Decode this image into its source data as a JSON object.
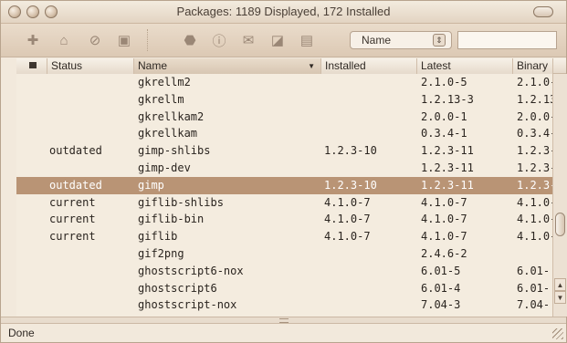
{
  "window": {
    "title": "Packages: 1189 Displayed, 172 Installed"
  },
  "toolbar": {
    "sort_select_value": "Name",
    "search_value": "",
    "buttons": [
      {
        "name": "install-icon",
        "glyph": "✚"
      },
      {
        "name": "install-binary-icon",
        "glyph": "⌂"
      },
      {
        "name": "remove-icon",
        "glyph": "⊘"
      },
      {
        "name": "package-icon",
        "glyph": "▣"
      },
      {
        "name": "stop-icon",
        "glyph": "⬣"
      },
      {
        "name": "info-icon",
        "glyph": "ⓘ"
      },
      {
        "name": "feedback-icon",
        "glyph": "✉"
      },
      {
        "name": "terminal-icon",
        "glyph": "◪"
      },
      {
        "name": "preferences-icon",
        "glyph": "▤"
      }
    ]
  },
  "table": {
    "columns": {
      "status": "Status",
      "name": "Name",
      "installed": "Installed",
      "latest": "Latest",
      "binary": "Binary"
    },
    "rows": [
      {
        "status": "",
        "name": "gkrellm2",
        "installed": "",
        "latest": "2.1.0-5",
        "binary": "2.1.0-"
      },
      {
        "status": "",
        "name": "gkrellm",
        "installed": "",
        "latest": "1.2.13-3",
        "binary": "1.2.13"
      },
      {
        "status": "",
        "name": "gkrellkam2",
        "installed": "",
        "latest": "2.0.0-1",
        "binary": "2.0.0-"
      },
      {
        "status": "",
        "name": "gkrellkam",
        "installed": "",
        "latest": "0.3.4-1",
        "binary": "0.3.4-"
      },
      {
        "status": "outdated",
        "name": "gimp-shlibs",
        "installed": "1.2.3-10",
        "latest": "1.2.3-11",
        "binary": "1.2.3-"
      },
      {
        "status": "",
        "name": "gimp-dev",
        "installed": "",
        "latest": "1.2.3-11",
        "binary": "1.2.3-"
      },
      {
        "status": "outdated",
        "name": "gimp",
        "installed": "1.2.3-10",
        "latest": "1.2.3-11",
        "binary": "1.2.3-",
        "selected": true
      },
      {
        "status": "current",
        "name": "giflib-shlibs",
        "installed": "4.1.0-7",
        "latest": "4.1.0-7",
        "binary": "4.1.0-"
      },
      {
        "status": "current",
        "name": "giflib-bin",
        "installed": "4.1.0-7",
        "latest": "4.1.0-7",
        "binary": "4.1.0-"
      },
      {
        "status": "current",
        "name": "giflib",
        "installed": "4.1.0-7",
        "latest": "4.1.0-7",
        "binary": "4.1.0-"
      },
      {
        "status": "",
        "name": "gif2png",
        "installed": "",
        "latest": "2.4.6-2",
        "binary": ""
      },
      {
        "status": "",
        "name": "ghostscript6-nox",
        "installed": "",
        "latest": "6.01-5",
        "binary": "6.01-"
      },
      {
        "status": "",
        "name": "ghostscript6",
        "installed": "",
        "latest": "6.01-4",
        "binary": "6.01-"
      },
      {
        "status": "",
        "name": "ghostscript-nox",
        "installed": "",
        "latest": "7.04-3",
        "binary": "7.04-"
      }
    ]
  },
  "status_bar": {
    "text": "Done"
  },
  "colors": {
    "selection": "#b99475",
    "background": "#f4ecdf"
  }
}
